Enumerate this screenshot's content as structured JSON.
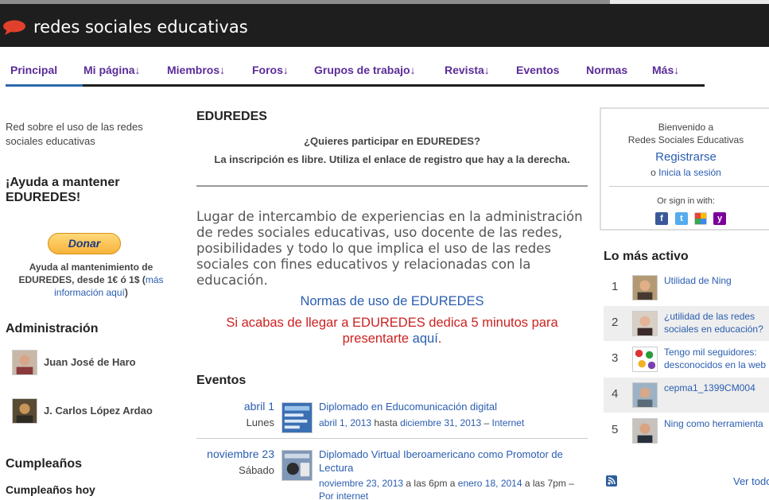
{
  "header": {
    "site_title": "redes sociales educativas"
  },
  "nav": {
    "items": [
      "Principal",
      "Mi página↓",
      "Miembros↓",
      "Foros↓",
      "Grupos de trabajo↓",
      "Revista↓",
      "Eventos",
      "Normas",
      "Más↓"
    ],
    "active": "Principal"
  },
  "left": {
    "description": "Red sobre el uso de las redes sociales educativas",
    "donate_heading": "¡Ayuda a mantener EDUREDES!",
    "donate_button": "Donar",
    "donate_text": "Ayuda al mantenimiento de EDUREDES, desde 1€ ó 1$ (",
    "donate_link": "más información aquí",
    "donate_close": ")",
    "admin_heading": "Administración",
    "admins": [
      "Juan José de Haro",
      "J. Carlos López Ardao"
    ],
    "birthdays_heading": "Cumpleaños",
    "birthdays_today": "Cumpleaños hoy"
  },
  "main": {
    "title": "EDUREDES",
    "question": "¿Quieres participar en EDUREDES?",
    "signup_note": "La inscripción es libre. Utiliza el enlace de registro que hay a la derecha.",
    "description": "Lugar de intercambio de experiencias en la administración de redes sociales educativas, uso docente de las redes, posibilidades y todo lo que implica el uso de las redes sociales con fines educativos y relacionadas con la educación.",
    "rules_link": "Normas de uso de EDUREDES",
    "welcome_text": "Si acabas de llegar a EDUREDES dedica 5 minutos para presentarte ",
    "welcome_link": "aquí",
    "welcome_end": ".",
    "events_heading": "Eventos",
    "events": [
      {
        "date": "abril 1",
        "day": "Lunes",
        "title": "Diplomado en Educomunicación digital",
        "start": "abril 1, 2013",
        "sep": " hasta ",
        "end": "diciembre 31, 2013",
        "dash": " – ",
        "place": "Internet"
      },
      {
        "date": "noviembre 23",
        "day": "Sábado",
        "title": "Diplomado Virtual Iberoamericano como Promotor de Lectura",
        "start": "noviembre 23, 2013",
        "start_time": " a las 6pm a ",
        "end": "enero 18, 2014",
        "end_time": " a las 7pm – ",
        "place": "Por internet"
      }
    ]
  },
  "signin": {
    "welcome": "Bienvenido a",
    "network": "Redes Sociales Educativas",
    "register": "Registrarse",
    "or": "o ",
    "login": "Inicia la sesión",
    "or_signin": "Or sign in with:",
    "providers": [
      "facebook-icon",
      "twitter-icon",
      "google-icon",
      "yahoo-icon"
    ]
  },
  "most_active": {
    "heading": "Lo más activo",
    "items": [
      {
        "rank": "1",
        "text": "Utilidad de Ning"
      },
      {
        "rank": "2",
        "text": "¿utilidad de las redes",
        "text2": "sociales en educación?"
      },
      {
        "rank": "3",
        "text": "Tengo mil seguidores:",
        "text2": "desconocidos en la web"
      },
      {
        "rank": "4",
        "text": "cepma1_1399CM004"
      },
      {
        "rank": "5",
        "text": "Ning como herramienta"
      }
    ],
    "view_all": "Ver todo"
  },
  "colors": {
    "topbar": "#1e1e1e",
    "nav_link": "#5b2c98",
    "link": "#2a5db0",
    "alert": "#cc2222"
  }
}
